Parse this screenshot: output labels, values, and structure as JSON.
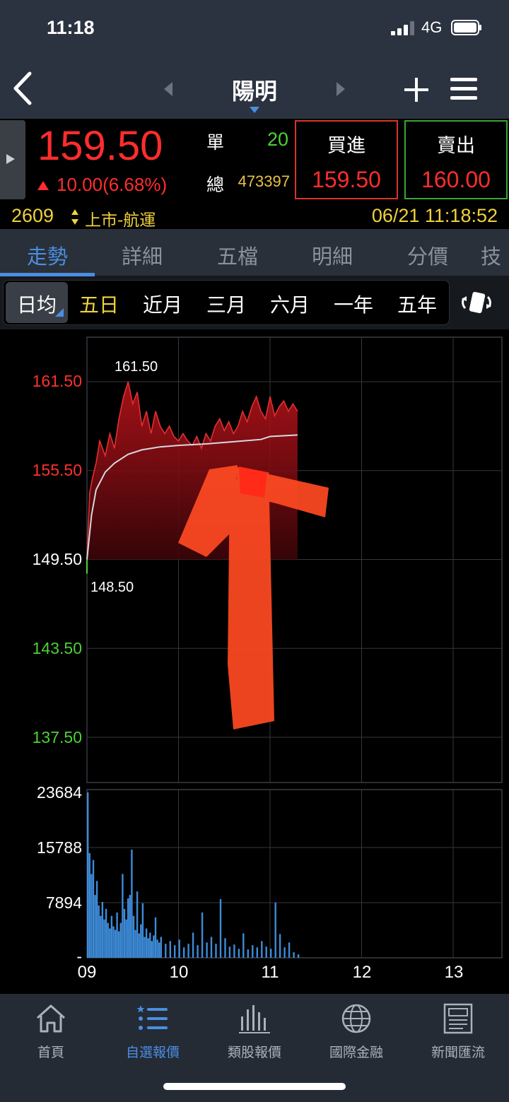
{
  "status": {
    "time": "11:18",
    "network": "4G"
  },
  "header": {
    "stock_name": "陽明"
  },
  "quote": {
    "price": "159.50",
    "change": "10.00(6.68%)",
    "single_label": "單",
    "single_value": "20",
    "total_label": "總",
    "total_value": "473397",
    "buy_label": "買進",
    "buy_price": "159.50",
    "sell_label": "賣出",
    "sell_price": "160.00",
    "code": "2609",
    "market": "上市-航運",
    "datetime": "06/21 11:18:52"
  },
  "tabs": [
    "走勢",
    "詳細",
    "五檔",
    "明細",
    "分價",
    "技"
  ],
  "active_tab": "走勢",
  "periods": [
    "日均",
    "五日",
    "近月",
    "三月",
    "六月",
    "一年",
    "五年"
  ],
  "selected_period": "日均",
  "colors": {
    "up": "#ff2d2d",
    "down": "#4cd137",
    "accent": "#4a8ee0",
    "highlight": "#f0d23c"
  },
  "chart_data": [
    {
      "type": "area",
      "title": "",
      "y_ticks": [
        "161.50",
        "155.50",
        "149.50",
        "143.50",
        "137.50"
      ],
      "ylim": [
        137.5,
        161.5
      ],
      "reference_price": 149.5,
      "annotations": {
        "high": "161.50",
        "low": "148.50"
      },
      "x_ticks": [
        "09",
        "10",
        "11",
        "12",
        "13"
      ],
      "series": [
        {
          "x": [
            9.0,
            9.03,
            9.06,
            9.1,
            9.14,
            9.2,
            9.25,
            9.3,
            9.35,
            9.4,
            9.45,
            9.5,
            9.55,
            9.6,
            9.65,
            9.7,
            9.75,
            9.8,
            9.85,
            9.9,
            9.95,
            10.0,
            10.05,
            10.1,
            10.15,
            10.2,
            10.25,
            10.3,
            10.35,
            10.4,
            10.45,
            10.5,
            10.55,
            10.6,
            10.65,
            10.7,
            10.75,
            10.8,
            10.85,
            10.9,
            10.95,
            11.0,
            11.05,
            11.1,
            11.15,
            11.2,
            11.25,
            11.3
          ],
          "values": [
            149.5,
            154.0,
            155.0,
            156.0,
            157.5,
            156.5,
            158.0,
            157.0,
            159.0,
            160.5,
            161.5,
            160.0,
            160.8,
            158.5,
            159.5,
            158.0,
            159.5,
            158.5,
            158.0,
            158.5,
            157.8,
            157.5,
            158.0,
            157.5,
            157.2,
            157.8,
            157.0,
            158.0,
            157.5,
            158.5,
            159.0,
            158.2,
            158.8,
            158.0,
            158.5,
            159.5,
            158.8,
            159.8,
            160.5,
            159.5,
            159.0,
            160.5,
            159.2,
            159.8,
            160.2,
            159.5,
            160.0,
            159.5
          ]
        },
        {
          "x": [
            9.0,
            9.05,
            9.1,
            9.2,
            9.3,
            9.45,
            9.6,
            9.8,
            10.0,
            10.3,
            10.6,
            10.9,
            11.0,
            11.3
          ],
          "values": [
            149.5,
            152.5,
            154.2,
            155.4,
            156.0,
            156.6,
            156.9,
            157.1,
            157.2,
            157.3,
            157.45,
            157.6,
            157.8,
            157.9
          ]
        }
      ]
    },
    {
      "type": "bar",
      "y_ticks": [
        "23684",
        "15788",
        "7894",
        "-"
      ],
      "ylim": [
        0,
        23684
      ],
      "x_ticks": [
        "09",
        "10",
        "11",
        "12",
        "13"
      ],
      "x": [
        9.0,
        9.02,
        9.04,
        9.06,
        9.08,
        9.1,
        9.12,
        9.14,
        9.16,
        9.18,
        9.2,
        9.22,
        9.24,
        9.26,
        9.28,
        9.3,
        9.32,
        9.34,
        9.36,
        9.38,
        9.4,
        9.42,
        9.44,
        9.46,
        9.48,
        9.5,
        9.52,
        9.54,
        9.56,
        9.58,
        9.6,
        9.62,
        9.64,
        9.66,
        9.68,
        9.7,
        9.72,
        9.74,
        9.76,
        9.78,
        9.8,
        9.85,
        9.9,
        9.95,
        10.0,
        10.05,
        10.1,
        10.15,
        10.2,
        10.25,
        10.3,
        10.35,
        10.4,
        10.45,
        10.5,
        10.55,
        10.6,
        10.65,
        10.7,
        10.75,
        10.8,
        10.85,
        10.9,
        10.95,
        11.0,
        11.05,
        11.1,
        11.15,
        11.2,
        11.25,
        11.3
      ],
      "values": [
        23684,
        15000,
        12000,
        14000,
        9000,
        11000,
        7500,
        6000,
        8000,
        5500,
        7000,
        5000,
        4200,
        6000,
        4500,
        4000,
        6500,
        3800,
        5000,
        12000,
        7000,
        5500,
        8500,
        9000,
        15500,
        6000,
        4000,
        9500,
        3500,
        4800,
        7800,
        3000,
        4200,
        2800,
        3600,
        2400,
        3200,
        5800,
        2600,
        2200,
        3000,
        2000,
        2400,
        1800,
        2600,
        1500,
        2000,
        3600,
        1800,
        6500,
        2200,
        3000,
        2000,
        8400,
        2800,
        1600,
        1900,
        1300,
        3500,
        1200,
        1800,
        1500,
        2400,
        1600,
        1300,
        7900,
        3400,
        1500,
        2200,
        800,
        500
      ]
    }
  ],
  "bottom_nav": [
    {
      "label": "首頁",
      "icon": "home-icon"
    },
    {
      "label": "自選報價",
      "icon": "watchlist-icon"
    },
    {
      "label": "類股報價",
      "icon": "sector-chart-icon"
    },
    {
      "label": "國際金融",
      "icon": "globe-icon"
    },
    {
      "label": "新聞匯流",
      "icon": "news-icon"
    }
  ],
  "active_nav": "自選報價"
}
